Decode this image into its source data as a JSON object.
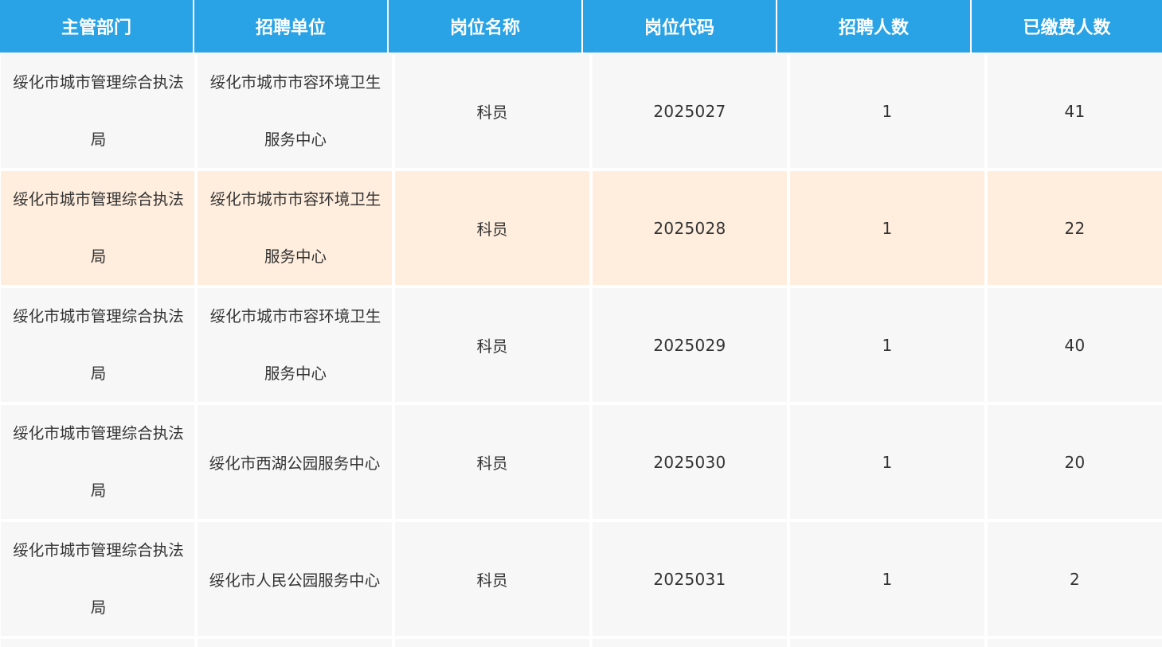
{
  "table": {
    "headers": [
      "主管部门",
      "招聘单位",
      "岗位名称",
      "岗位代码",
      "招聘人数",
      "已缴费人数"
    ],
    "rows": [
      {
        "dept": [
          "绥化市城市管理综合执法",
          "局"
        ],
        "unit": [
          "绥化市城市市容环境卫生",
          "服务中心"
        ],
        "position": "科员",
        "code": "2025027",
        "openings": "1",
        "paid": "41"
      },
      {
        "dept": [
          "绥化市城市管理综合执法",
          "局"
        ],
        "unit": [
          "绥化市城市市容环境卫生",
          "服务中心"
        ],
        "position": "科员",
        "code": "2025028",
        "openings": "1",
        "paid": "22"
      },
      {
        "dept": [
          "绥化市城市管理综合执法",
          "局"
        ],
        "unit": [
          "绥化市城市市容环境卫生",
          "服务中心"
        ],
        "position": "科员",
        "code": "2025029",
        "openings": "1",
        "paid": "40"
      },
      {
        "dept": [
          "绥化市城市管理综合执法",
          "局"
        ],
        "unit": [
          "绥化市西湖公园服务中心"
        ],
        "position": "科员",
        "code": "2025030",
        "openings": "1",
        "paid": "20"
      },
      {
        "dept": [
          "绥化市城市管理综合执法",
          "局"
        ],
        "unit": [
          "绥化市人民公园服务中心"
        ],
        "position": "科员",
        "code": "2025031",
        "openings": "1",
        "paid": "2"
      }
    ],
    "highlighted_row": 1,
    "colors": {
      "header_bg": "#29a3e6",
      "row_bg": "#f7f7f7",
      "highlight_bg": "#ffeddd"
    }
  }
}
